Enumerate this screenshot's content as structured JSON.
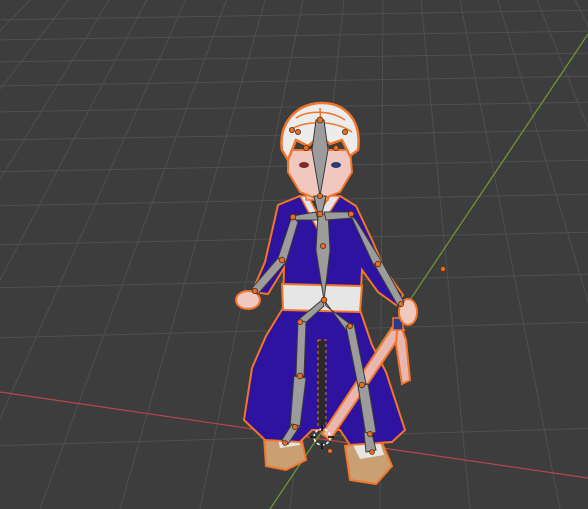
{
  "viewport": {
    "background": "#3d3d3d",
    "grid_color": "#4f4f4f",
    "x_axis_color": "#b8464e",
    "y_axis_color": "#6f9a33",
    "selection_outline_color": "#f2752a",
    "armature_bone_color": "#9c9c9c",
    "joint_color": "#e0702a",
    "robe_color": "#2e12a0",
    "sash_color": "#e6e6e6",
    "skin_color": "#f0c8c0",
    "sandal_color": "#c9a074",
    "sword_color": "#e8b8b0"
  },
  "objects": {
    "character": "character-mesh",
    "armature": "armature",
    "origin": "3d-cursor-icon"
  }
}
